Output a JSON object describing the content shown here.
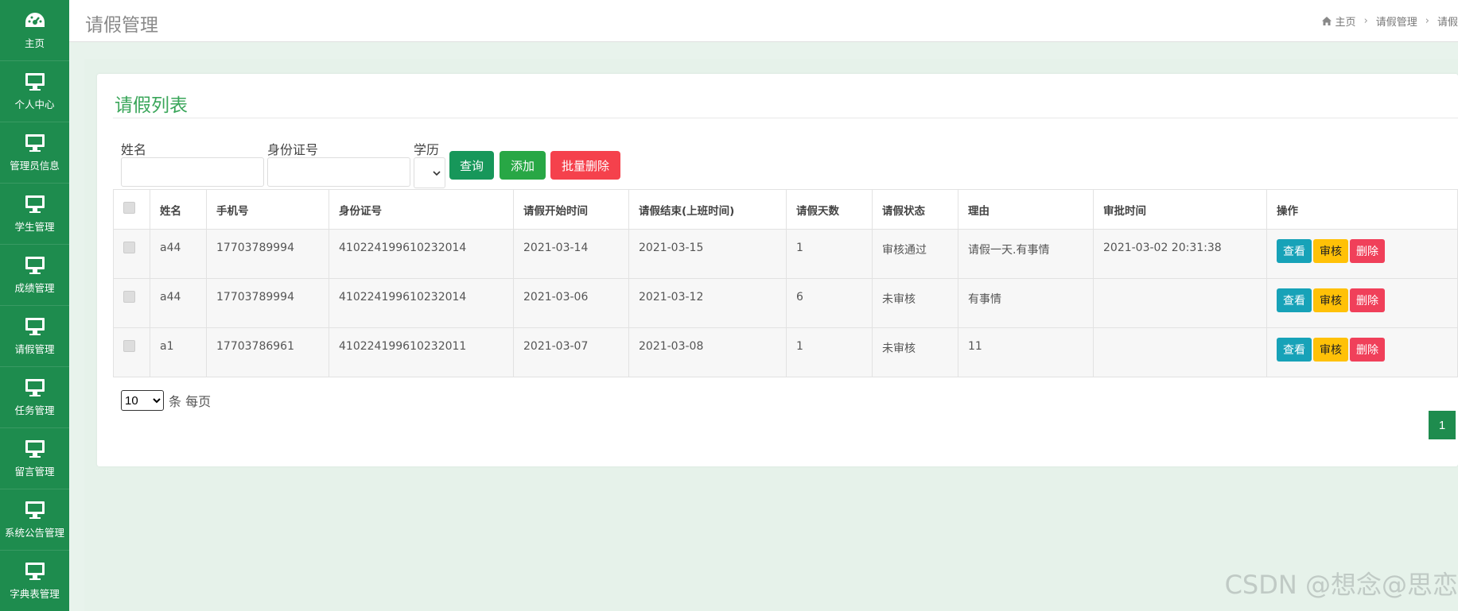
{
  "sidebar": {
    "items": [
      {
        "label": "主页",
        "icon": "dashboard-icon"
      },
      {
        "label": "个人中心",
        "icon": "monitor-icon"
      },
      {
        "label": "管理员信息",
        "icon": "monitor-icon"
      },
      {
        "label": "学生管理",
        "icon": "monitor-icon"
      },
      {
        "label": "成绩管理",
        "icon": "monitor-icon"
      },
      {
        "label": "请假管理",
        "icon": "monitor-icon"
      },
      {
        "label": "任务管理",
        "icon": "monitor-icon"
      },
      {
        "label": "留言管理",
        "icon": "monitor-icon"
      },
      {
        "label": "系统公告管理",
        "icon": "monitor-icon"
      },
      {
        "label": "字典表管理",
        "icon": "monitor-icon"
      }
    ]
  },
  "header": {
    "title": "请假管理",
    "breadcrumb": [
      "主页",
      "请假管理",
      "请假"
    ]
  },
  "card": {
    "title": "请假列表"
  },
  "search": {
    "name_label": "姓名",
    "name_value": "",
    "idcard_label": "身份证号",
    "idcard_value": "",
    "education_label": "学历",
    "query_label": "查询",
    "add_label": "添加",
    "batch_delete_label": "批量删除"
  },
  "table": {
    "headers": [
      "姓名",
      "手机号",
      "身份证号",
      "请假开始时间",
      "请假结束(上班时间)",
      "请假天数",
      "请假状态",
      "理由",
      "审批时间",
      "操作"
    ],
    "rows": [
      {
        "name": "a44",
        "phone": "17703789994",
        "idcard": "410224199610232014",
        "start": "2021-03-14",
        "end": "2021-03-15",
        "days": "1",
        "status": "审核通过",
        "reason": "请假一天.有事情",
        "approve_time": "2021-03-02 20:31:38"
      },
      {
        "name": "a44",
        "phone": "17703789994",
        "idcard": "410224199610232014",
        "start": "2021-03-06",
        "end": "2021-03-12",
        "days": "6",
        "status": "未审核",
        "reason": "有事情",
        "approve_time": ""
      },
      {
        "name": "a1",
        "phone": "17703786961",
        "idcard": "410224199610232011",
        "start": "2021-03-07",
        "end": "2021-03-08",
        "days": "1",
        "status": "未审核",
        "reason": "11",
        "approve_time": ""
      }
    ],
    "actions": {
      "view": "查看",
      "audit": "审核",
      "delete": "删除"
    }
  },
  "pagination": {
    "per_page_value": "10",
    "per_page_suffix": "条 每页",
    "current_page": "1"
  },
  "watermark": "CSDN @想念@思恋",
  "colors": {
    "sidebar": "#1e8c4e",
    "query_btn": "#17975a",
    "add_btn": "#28a745",
    "batch_delete_btn": "#f5414c",
    "view_btn": "#17a2b8",
    "audit_btn": "#ffc107",
    "delete_btn": "#f0405a"
  }
}
